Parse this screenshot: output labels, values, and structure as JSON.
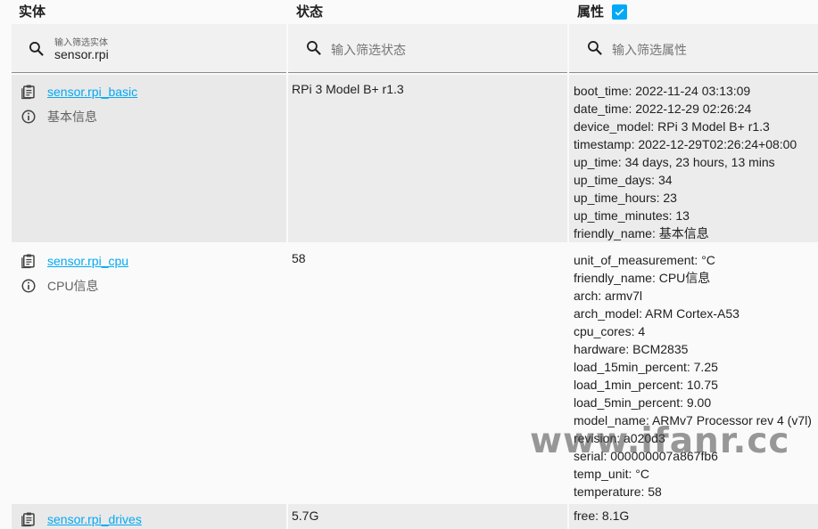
{
  "header": {
    "entity": "实体",
    "state": "状态",
    "attributes": "属性",
    "attributes_checked": true
  },
  "filters": {
    "entity": {
      "label": "输入筛选实体",
      "value": "sensor.rpi"
    },
    "state": {
      "placeholder": "输入筛选状态"
    },
    "attributes": {
      "placeholder": "输入筛选属性"
    }
  },
  "rows": [
    {
      "entity_id": "sensor.rpi_basic",
      "friendly_name": "基本信息",
      "state": "RPi 3 Model B+ r1.3",
      "attributes": [
        "boot_time: 2022-11-24 03:13:09",
        "date_time: 2022-12-29 02:26:24",
        "device_model: RPi 3 Model B+ r1.3",
        "timestamp: 2022-12-29T02:26:24+08:00",
        "up_time: 34 days, 23 hours, 13 mins",
        "up_time_days: 34",
        "up_time_hours: 23",
        "up_time_minutes: 13",
        "friendly_name: 基本信息"
      ]
    },
    {
      "entity_id": "sensor.rpi_cpu",
      "friendly_name": "CPU信息",
      "state": "58",
      "attributes": [
        "unit_of_measurement: °C",
        "friendly_name: CPU信息",
        "arch: armv7l",
        "arch_model: ARM Cortex-A53",
        "cpu_cores: 4",
        "hardware: BCM2835",
        "load_15min_percent: 7.25",
        "load_1min_percent: 10.75",
        "load_5min_percent: 9.00",
        "model_name: ARMv7 Processor rev 4 (v7l)",
        "revision: a020d3",
        "serial: 000000007a867fb6",
        "temp_unit: °C",
        "temperature: 58"
      ]
    },
    {
      "entity_id": "sensor.rpi_drives",
      "friendly_name": "",
      "state": "5.7G",
      "attributes": [
        "free: 8.1G"
      ]
    }
  ],
  "watermark": "www.ifanr.cc",
  "colors": {
    "link": "#03a9f4",
    "row_shaded": "#eeeeee",
    "background": "#fafafa"
  }
}
